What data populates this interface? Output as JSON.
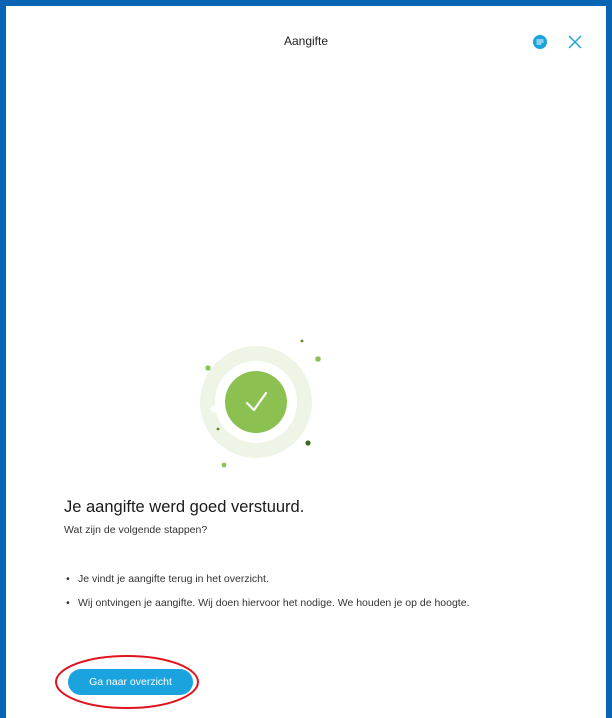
{
  "header": {
    "title": "Aangifte",
    "chat_icon": "chat-bubble-icon",
    "close_icon": "close-icon",
    "accent_color": "#1aa3de"
  },
  "illustration": {
    "icon": "checkmark-icon",
    "colors": {
      "outer_ring": "#eef5e6",
      "middle_ring": "#ffffff",
      "inner_circle": "#8cc152",
      "dots": "#8cc152"
    }
  },
  "main": {
    "title": "Je aangifte werd goed verstuurd.",
    "subtitle": "Wat zijn de volgende stappen?",
    "steps": [
      "Je vindt je aangifte terug in het overzicht.",
      "Wij ontvingen je aangifte. Wij doen hiervoor het nodige. We houden je op de hoogte."
    ],
    "button_label": "Ga naar overzicht"
  },
  "frame": {
    "border_color": "#0a64b4"
  },
  "annotation": {
    "color": "#e0141e"
  }
}
